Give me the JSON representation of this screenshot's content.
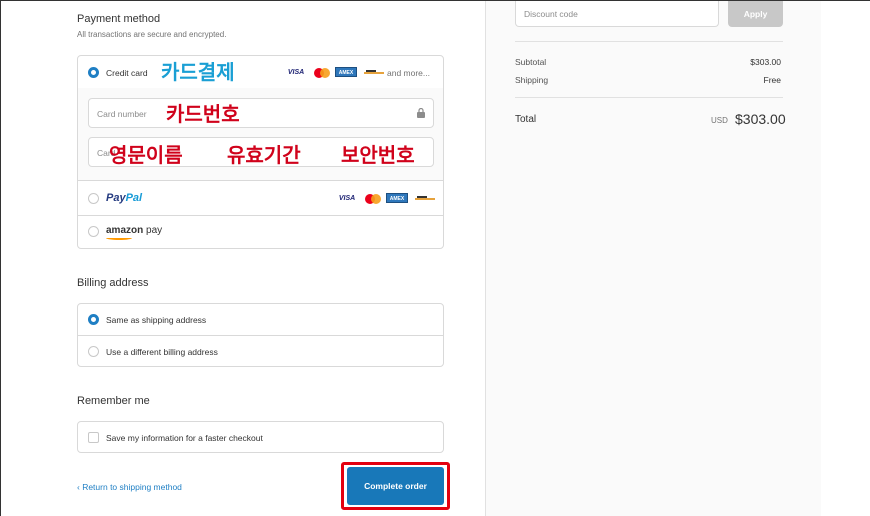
{
  "payment": {
    "title": "Payment method",
    "subtitle": "All transactions are secure and encrypted.",
    "credit_card_label": "Credit card",
    "card_brands": [
      "VISA",
      "AMEX"
    ],
    "and_more": "and more...",
    "card_number_placeholder": "Card number",
    "card_name_placeholder": "Card",
    "paypal_brand_1": "Pay",
    "paypal_brand_2": "Pal",
    "amazon_brand": "amazon",
    "amazon_suffix": " pay"
  },
  "overlays": {
    "card_payment": "카드결제",
    "card_number": "카드번호",
    "english_name": "영문이름",
    "expiry": "유효기간",
    "security_code": "보안번호"
  },
  "billing": {
    "title": "Billing address",
    "same_label": "Same as shipping address",
    "different_label": "Use a different billing address"
  },
  "remember": {
    "title": "Remember me",
    "checkbox_label": "Save my information for a faster checkout"
  },
  "actions": {
    "return_link": "‹ Return to shipping method",
    "complete_order": "Complete order"
  },
  "summary": {
    "discount_placeholder": "Discount code",
    "apply_label": "Apply",
    "subtotal_label": "Subtotal",
    "subtotal_value": "$303.00",
    "shipping_label": "Shipping",
    "shipping_value": "Free",
    "total_label": "Total",
    "total_currency": "USD",
    "total_value": "$303.00"
  },
  "colors": {
    "accent": "#1878b9",
    "radio_selected": "#1f7fc4",
    "highlight_border": "#e3000f",
    "overlay_blue": "#1a9fd4",
    "overlay_red": "#d0021b"
  }
}
